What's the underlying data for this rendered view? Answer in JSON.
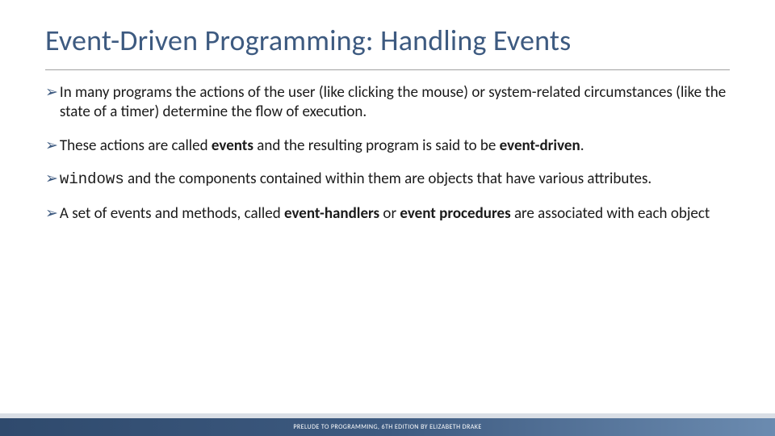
{
  "title": "Event-Driven Programming: Handling Events",
  "bullets": [
    {
      "html": "In many programs the actions of the user (like clicking the mouse) or system-related circumstances (like the state of a timer) determine the flow of execution."
    },
    {
      "html": "These actions are called <b>events</b> and the resulting program is said to be <b>event-driven</b>."
    },
    {
      "html": "<code>windows</code> and the components contained within them are objects that have various attributes."
    },
    {
      "html": "A set of events and methods, called <b>event-handlers</b> or <b>event procedures</b> are associated with each object"
    }
  ],
  "marker": "➢",
  "footer": "PRELUDE TO PROGRAMMING, 6TH EDITION BY ELIZABETH DRAKE"
}
